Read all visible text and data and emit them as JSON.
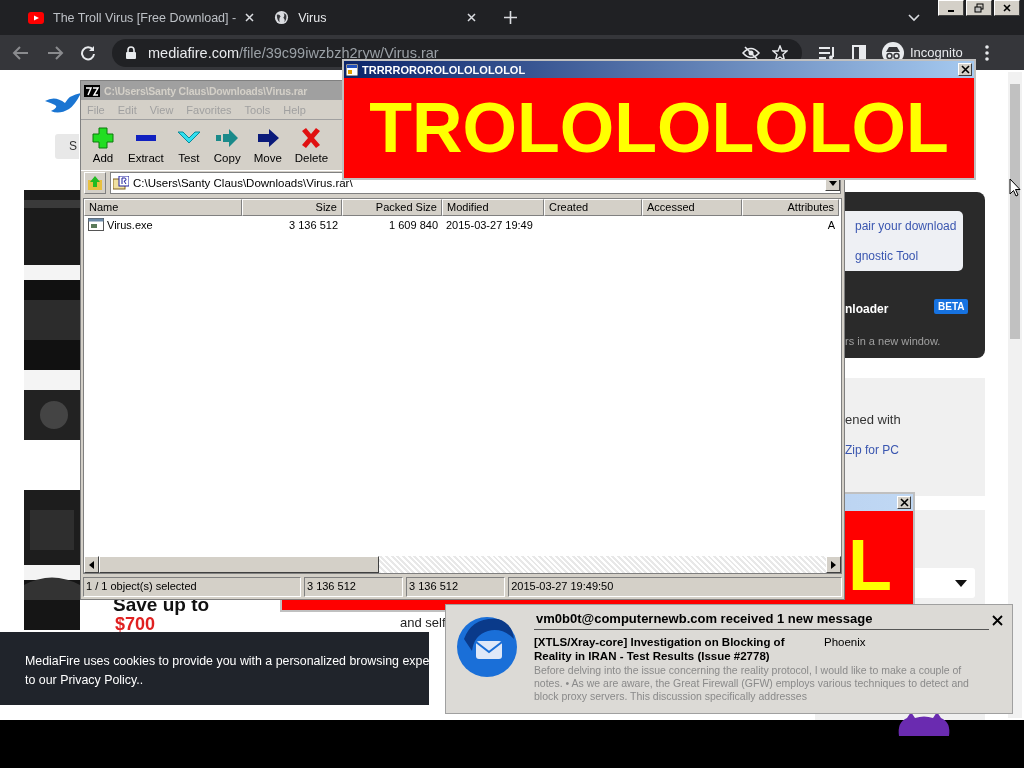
{
  "browser": {
    "tabs": [
      {
        "title": "The Troll Virus [Free Download] -",
        "kind": "video",
        "selected": false
      },
      {
        "title": "Virus",
        "kind": "globe",
        "selected": true
      }
    ],
    "url_host": "mediafire.com",
    "url_path": "/file/39c99iwzbzh2ryw/Virus.rar",
    "profile": "Incognito"
  },
  "page": {
    "signin_button": "S",
    "repair_link": "pair your download",
    "diagnostic_link": "gnostic Tool",
    "downloader_label": "nloader",
    "badge": "BETA",
    "new_window_note": "rs in a new window.",
    "opened_with": "ened with",
    "zip_link": "Zip for PC",
    "ad_headline": "Save up to",
    "ad_price": "$700",
    "snippet": "and self"
  },
  "archive_window": {
    "title": "C:\\Users\\Santy Claus\\Downloads\\Virus.rar",
    "active": false,
    "menu": [
      "File",
      "Edit",
      "View",
      "Favorites",
      "Tools",
      "Help"
    ],
    "toolbar": [
      {
        "label": "Add",
        "kind": "add"
      },
      {
        "label": "Extract",
        "kind": "extract"
      },
      {
        "label": "Test",
        "kind": "test"
      },
      {
        "label": "Copy",
        "kind": "copy"
      },
      {
        "label": "Move",
        "kind": "move"
      },
      {
        "label": "Delete",
        "kind": "delete"
      }
    ],
    "path": "C:\\Users\\Santy Claus\\Downloads\\Virus.rar\\",
    "columns": [
      {
        "label": "Name",
        "kind": "text"
      },
      {
        "label": "Size",
        "kind": "number"
      },
      {
        "label": "Packed Size",
        "kind": "number"
      },
      {
        "label": "Modified",
        "kind": "text"
      },
      {
        "label": "Created",
        "kind": "text"
      },
      {
        "label": "Accessed",
        "kind": "text"
      },
      {
        "label": "Attributes",
        "kind": "number"
      }
    ],
    "rows": [
      {
        "cells": [
          "Virus.exe",
          "3 136 512",
          "1 609 840",
          "2015-03-27 19:49",
          "",
          "",
          "A"
        ]
      }
    ],
    "status": [
      "1 / 1 object(s) selected",
      "3 136 512",
      "3 136 512",
      "2015-03-27 19:49:50"
    ]
  },
  "troll_popup": {
    "title": "TRRRROROROLOLOLOLOLOL",
    "message": "TROLOLOLOLOL"
  },
  "back_popup": {
    "message": "L"
  },
  "notification": {
    "header": "vm0b0t@computernewb.com received 1 new message",
    "subject": "[XTLS/Xray-core] Investigation on Blocking of Reality in IRAN - Test Results (Issue #2778)",
    "sender": "Phoenix",
    "preview": "Before delving into the issue concerning the reality protocol, I would like to make a couple of notes. • As we are aware, the Great Firewall (GFW) employs various techniques to detect and block proxy servers. This discussion specifically addresses"
  },
  "cookie_banner": {
    "lines": [
      "MediaFire uses cookies to provide you with a personalized browsing expe",
      "to our Privacy Policy.."
    ]
  }
}
